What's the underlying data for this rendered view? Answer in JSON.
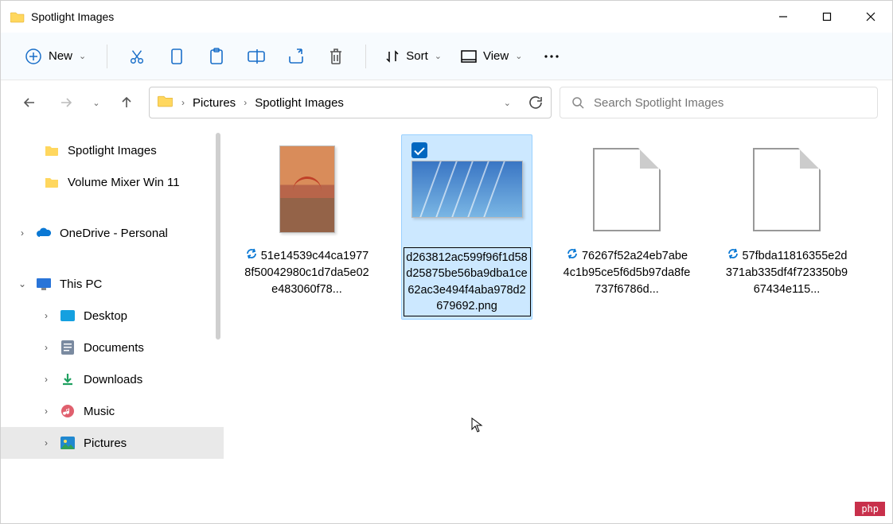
{
  "window": {
    "title": "Spotlight Images"
  },
  "toolbar": {
    "new_label": "New",
    "sort_label": "Sort",
    "view_label": "View"
  },
  "breadcrumb": {
    "items": [
      "Pictures",
      "Spotlight Images"
    ]
  },
  "search": {
    "placeholder": "Search Spotlight Images"
  },
  "sidebar": {
    "quick": [
      {
        "label": "Spotlight Images"
      },
      {
        "label": "Volume Mixer Win 11"
      }
    ],
    "onedrive": {
      "label": "OneDrive - Personal"
    },
    "thispc": {
      "label": "This PC",
      "children": [
        {
          "label": "Desktop"
        },
        {
          "label": "Documents"
        },
        {
          "label": "Downloads"
        },
        {
          "label": "Music"
        },
        {
          "label": "Pictures"
        }
      ]
    }
  },
  "files": [
    {
      "name": "51e14539c44ca19778f50042980c1d7da5e02e483060f78...",
      "sync": true,
      "thumb": "portrait",
      "selected": false,
      "editing": false
    },
    {
      "name": "d263812ac599f96f1d58d25875be56ba9dba1ce62ac3e494f4aba978d2679692.png",
      "sync": false,
      "thumb": "landscape",
      "selected": true,
      "editing": true
    },
    {
      "name": "76267f52a24eb7abe4c1b95ce5f6d5b97da8fe737f6786d...",
      "sync": true,
      "thumb": "file",
      "selected": false,
      "editing": false
    },
    {
      "name": "57fbda11816355e2d371ab335df4f723350b967434e115...",
      "sync": true,
      "thumb": "file",
      "selected": false,
      "editing": false
    }
  ],
  "watermark": "php"
}
